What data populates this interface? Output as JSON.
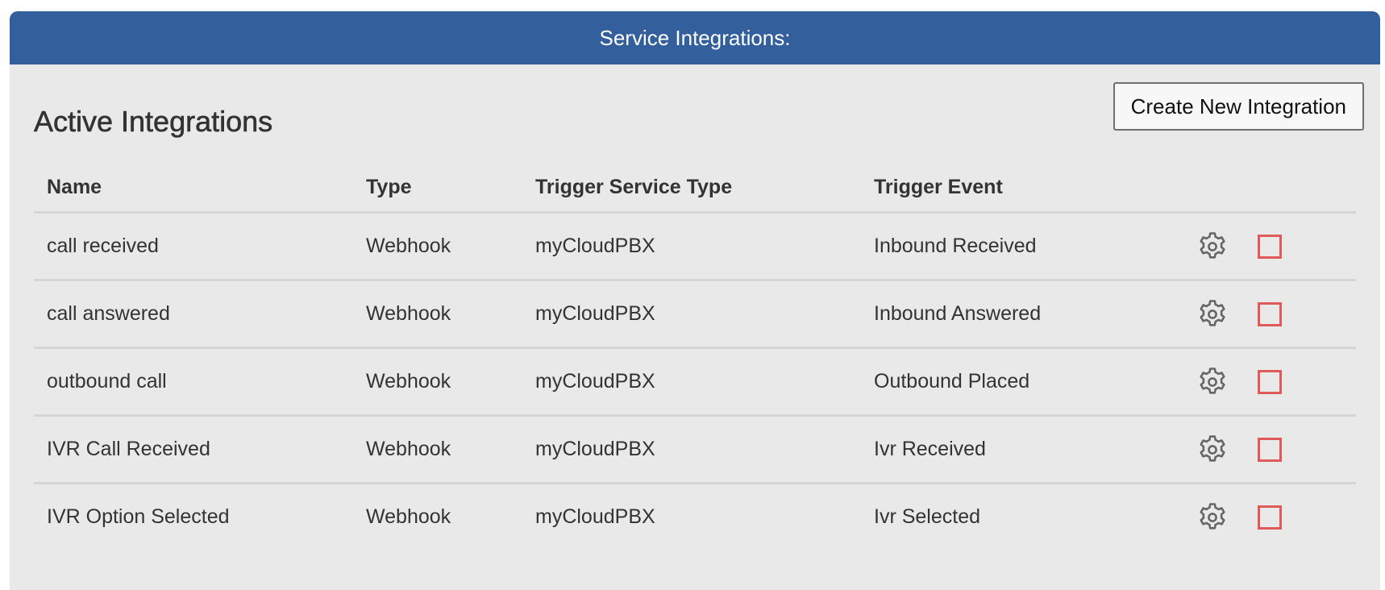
{
  "panel": {
    "header_title": "Service Integrations:",
    "section_title": "Active Integrations",
    "create_button_label": "Create New Integration"
  },
  "table": {
    "columns": [
      "Name",
      "Type",
      "Trigger Service Type",
      "Trigger Event"
    ],
    "rows": [
      {
        "name": "call received",
        "type": "Webhook",
        "service": "myCloudPBX",
        "event": "Inbound Received"
      },
      {
        "name": "call answered",
        "type": "Webhook",
        "service": "myCloudPBX",
        "event": "Inbound Answered"
      },
      {
        "name": "outbound call",
        "type": "Webhook",
        "service": "myCloudPBX",
        "event": "Outbound Placed"
      },
      {
        "name": "IVR Call Received",
        "type": "Webhook",
        "service": "myCloudPBX",
        "event": "Ivr Received"
      },
      {
        "name": "IVR Option Selected",
        "type": "Webhook",
        "service": "myCloudPBX",
        "event": "Ivr Selected"
      }
    ],
    "row_actions": {
      "settings_icon": "gear-icon",
      "delete_icon": "delete-checkbox"
    }
  },
  "colors": {
    "header_bg": "#33609c",
    "panel_bg": "#e9e9e9",
    "delete_red": "#e05a5a",
    "gear_gray": "#666666"
  }
}
